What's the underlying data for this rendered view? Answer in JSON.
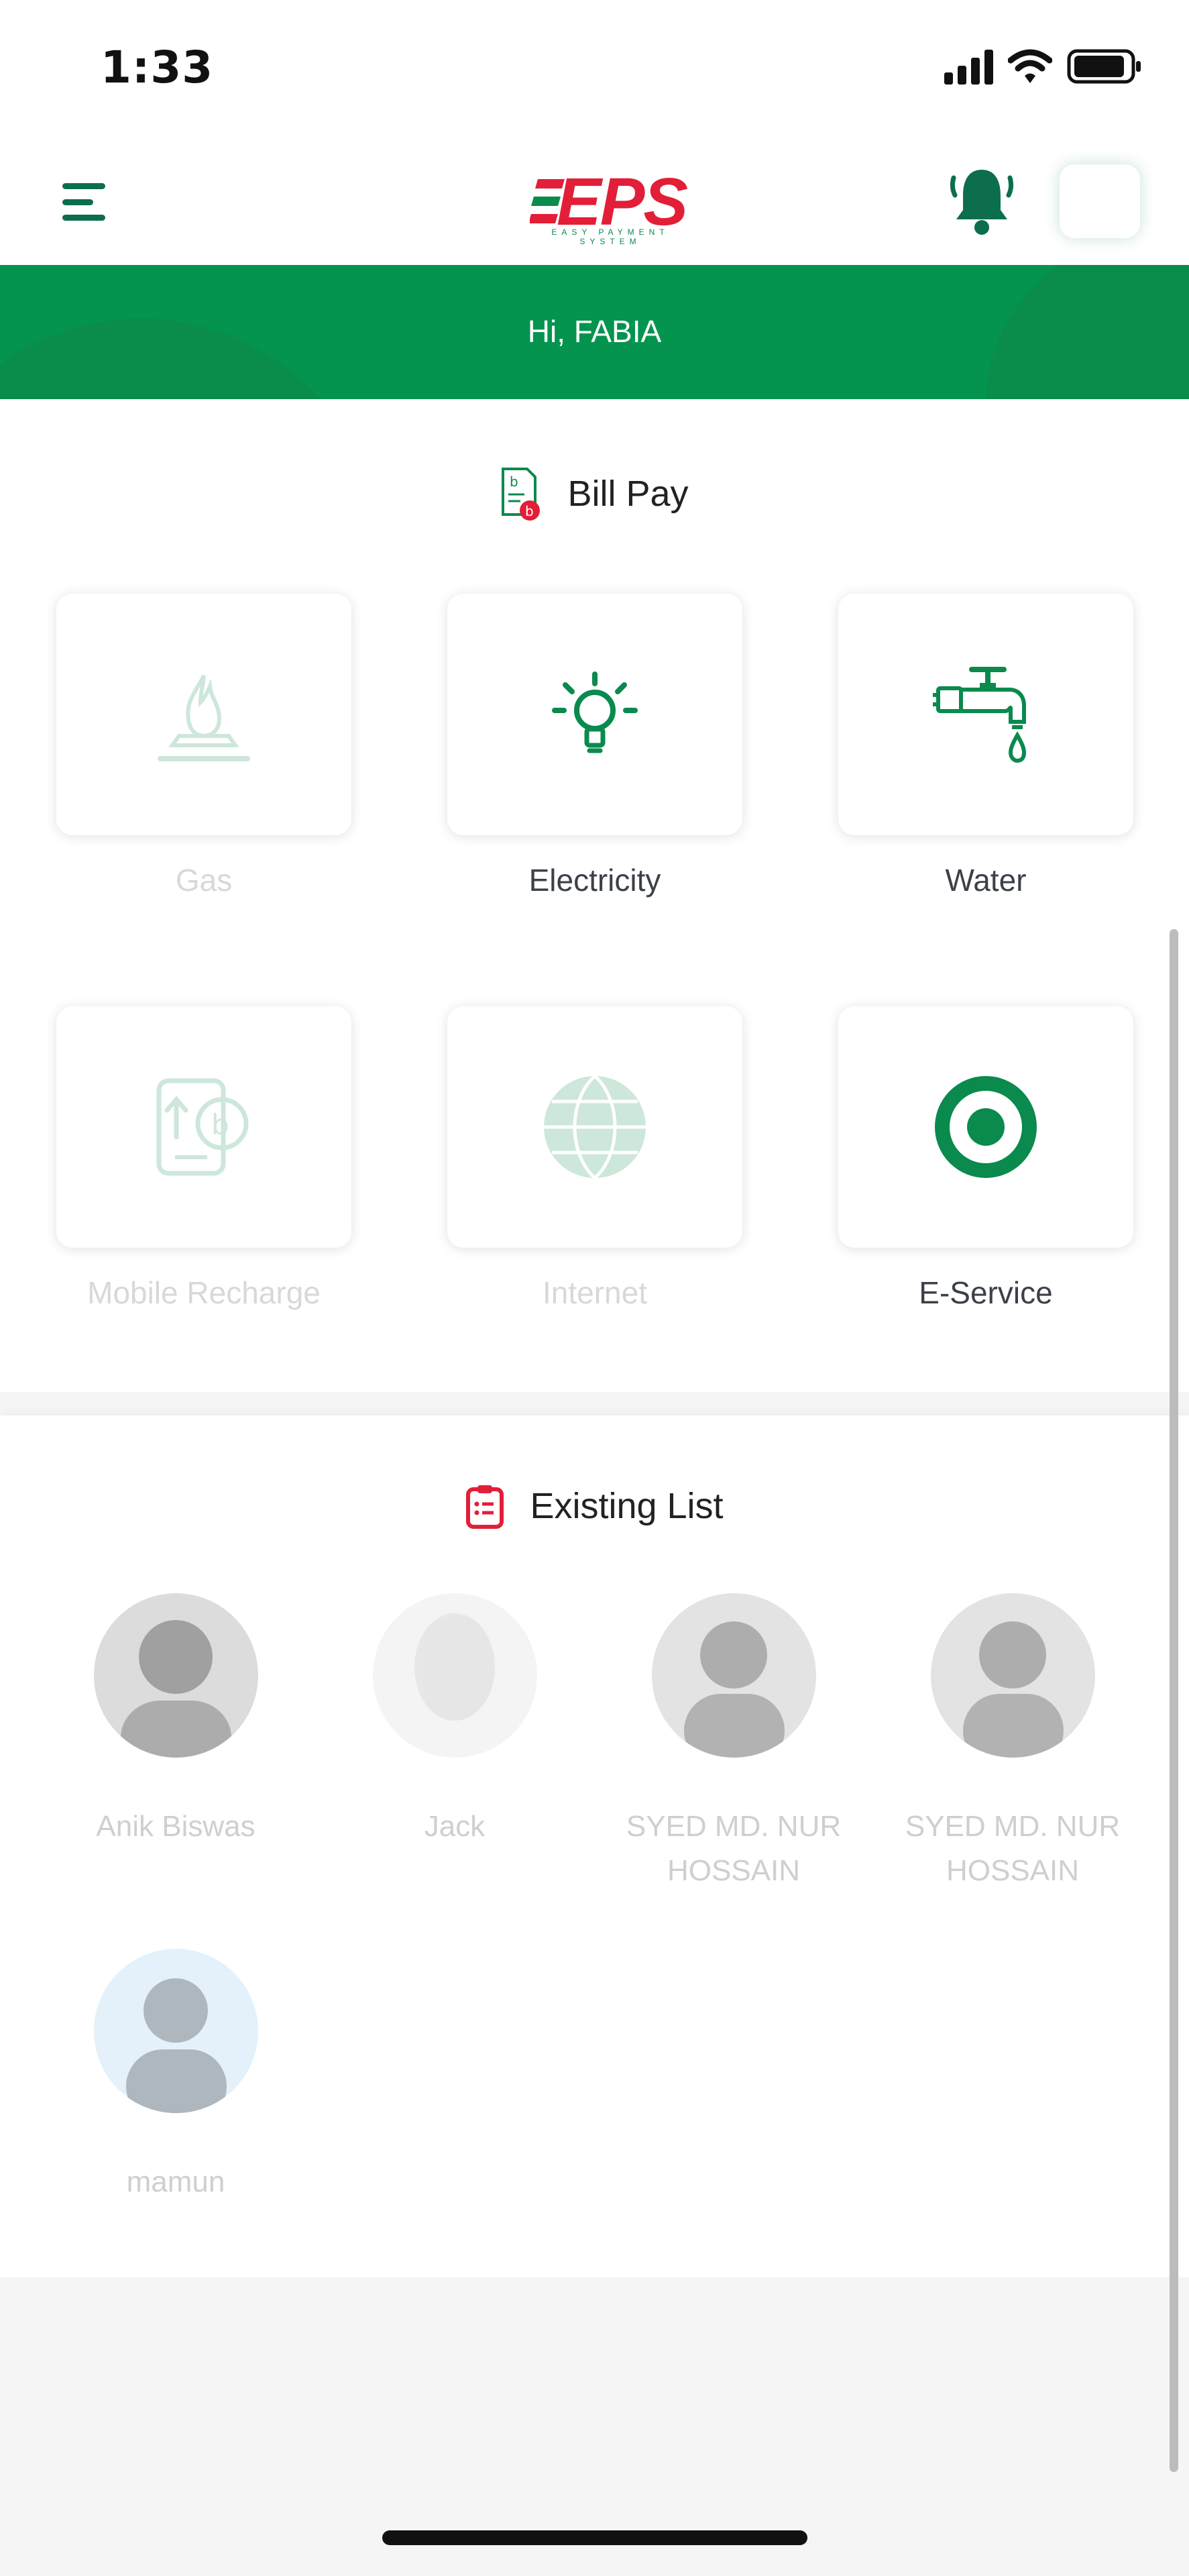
{
  "status_bar": {
    "time": "1:33"
  },
  "header": {
    "logo_text": "EPS",
    "logo_subtitle": "EASY PAYMENT SYSTEM"
  },
  "banner": {
    "greeting": "Hi, FABIA"
  },
  "bill_pay": {
    "title": "Bill Pay",
    "services": [
      {
        "label": "Gas",
        "icon": "gas-flame-icon",
        "enabled": false
      },
      {
        "label": "Electricity",
        "icon": "lightbulb-icon",
        "enabled": true
      },
      {
        "label": "Water",
        "icon": "water-tap-icon",
        "enabled": true
      },
      {
        "label": "Mobile Recharge",
        "icon": "mobile-recharge-icon",
        "enabled": false
      },
      {
        "label": "Internet",
        "icon": "globe-icon",
        "enabled": false
      },
      {
        "label": "E-Service",
        "icon": "target-icon",
        "enabled": true
      }
    ]
  },
  "existing_list": {
    "title": "Existing List",
    "contacts": [
      {
        "name": "Anik Biswas"
      },
      {
        "name": "Jack"
      },
      {
        "name": "SYED MD. NUR HOSSAIN"
      },
      {
        "name": "SYED MD. NUR HOSSAIN"
      },
      {
        "name": "mamun"
      }
    ]
  },
  "colors": {
    "brand_green": "#04944f",
    "brand_red": "#e31e38",
    "icon_green": "#0a8a4d"
  }
}
